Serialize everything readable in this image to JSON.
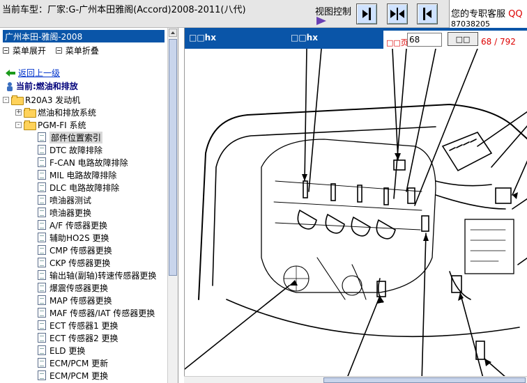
{
  "topbar": {
    "car_model": "当前车型：厂家:G-广州本田雅阁(Accord)2008-2011(八代)",
    "view_control": "视图控制",
    "service_label": "您的专职客服 ",
    "service_qq": "QQ",
    "service_phone": "87038205"
  },
  "left": {
    "tree_title": "广州本田-雅阁-2008",
    "expand_label": "菜单展开",
    "collapse_label": "菜单折叠",
    "back_label": "返回上一级",
    "current_label": "当前:燃油和排放",
    "tree": [
      {
        "label": "R20A3 发动机",
        "type": "folder",
        "exp": "-",
        "depth": 0
      },
      {
        "label": "燃油和排放系统",
        "type": "folder",
        "exp": "+",
        "depth": 1
      },
      {
        "label": "PGM-FI 系统",
        "type": "folder",
        "exp": "-",
        "depth": 1
      },
      {
        "label": "部件位置索引",
        "type": "doc",
        "depth": 2,
        "selected": true
      },
      {
        "label": "DTC 故障排除",
        "type": "doc",
        "depth": 2
      },
      {
        "label": "F-CAN 电路故障排除",
        "type": "doc",
        "depth": 2
      },
      {
        "label": "MIL 电路故障排除",
        "type": "doc",
        "depth": 2
      },
      {
        "label": "DLC 电路故障排除",
        "type": "doc",
        "depth": 2
      },
      {
        "label": "喷油器测试",
        "type": "doc",
        "depth": 2
      },
      {
        "label": "喷油器更换",
        "type": "doc",
        "depth": 2
      },
      {
        "label": "A/F 传感器更换",
        "type": "doc",
        "depth": 2
      },
      {
        "label": "辅助HO2S 更换",
        "type": "doc",
        "depth": 2
      },
      {
        "label": "CMP 传感器更换",
        "type": "doc",
        "depth": 2
      },
      {
        "label": "CKP 传感器更换",
        "type": "doc",
        "depth": 2
      },
      {
        "label": "输出轴(副轴)转速传感器更换",
        "type": "doc",
        "depth": 2
      },
      {
        "label": "爆震传感器更换",
        "type": "doc",
        "depth": 2
      },
      {
        "label": "MAP 传感器更换",
        "type": "doc",
        "depth": 2
      },
      {
        "label": "MAF 传感器/IAT 传感器更换",
        "type": "doc",
        "depth": 2
      },
      {
        "label": "ECT 传感器1 更换",
        "type": "doc",
        "depth": 2
      },
      {
        "label": "ECT 传感器2 更换",
        "type": "doc",
        "depth": 2
      },
      {
        "label": "ELD 更换",
        "type": "doc",
        "depth": 2
      },
      {
        "label": "ECM/PCM 更新",
        "type": "doc",
        "depth": 2
      },
      {
        "label": "ECM/PCM 更换",
        "type": "doc",
        "depth": 2
      }
    ]
  },
  "right": {
    "header1": "□□hx",
    "header2": "□□hx",
    "page_label": "□□页",
    "page_value": "68",
    "go_label": "□□",
    "page_count": "68 / 792"
  },
  "colors": {
    "header_blue": "#0a55a8",
    "accent_red": "#d00000",
    "folder_yellow": "#ffd25a"
  }
}
